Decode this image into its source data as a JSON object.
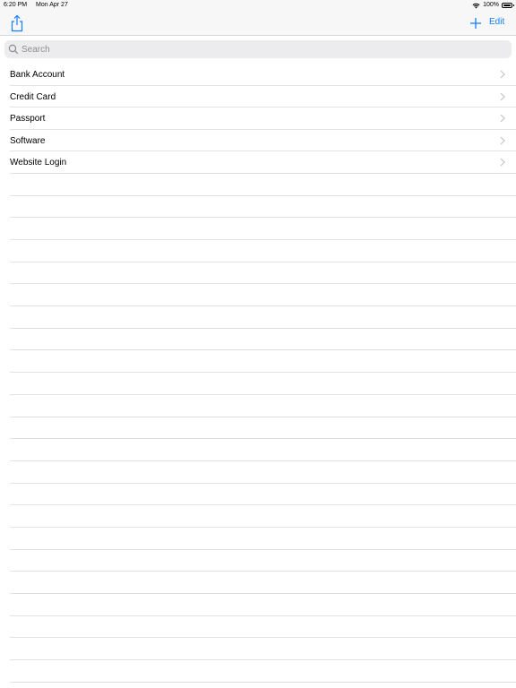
{
  "status_bar": {
    "time": "6:20 PM",
    "date": "Mon Apr 27",
    "battery": "100%",
    "wifi_icon": "wifi-icon",
    "battery_icon": "battery-icon"
  },
  "nav_bar": {
    "share_icon": "share-icon",
    "add_icon": "plus-icon",
    "edit_label": "Edit",
    "accent_color": "#147efb"
  },
  "search": {
    "placeholder": "Search",
    "value": ""
  },
  "list": {
    "items": [
      {
        "label": "Bank Account"
      },
      {
        "label": "Credit Card"
      },
      {
        "label": "Passport"
      },
      {
        "label": "Software"
      },
      {
        "label": "Website Login"
      }
    ]
  }
}
